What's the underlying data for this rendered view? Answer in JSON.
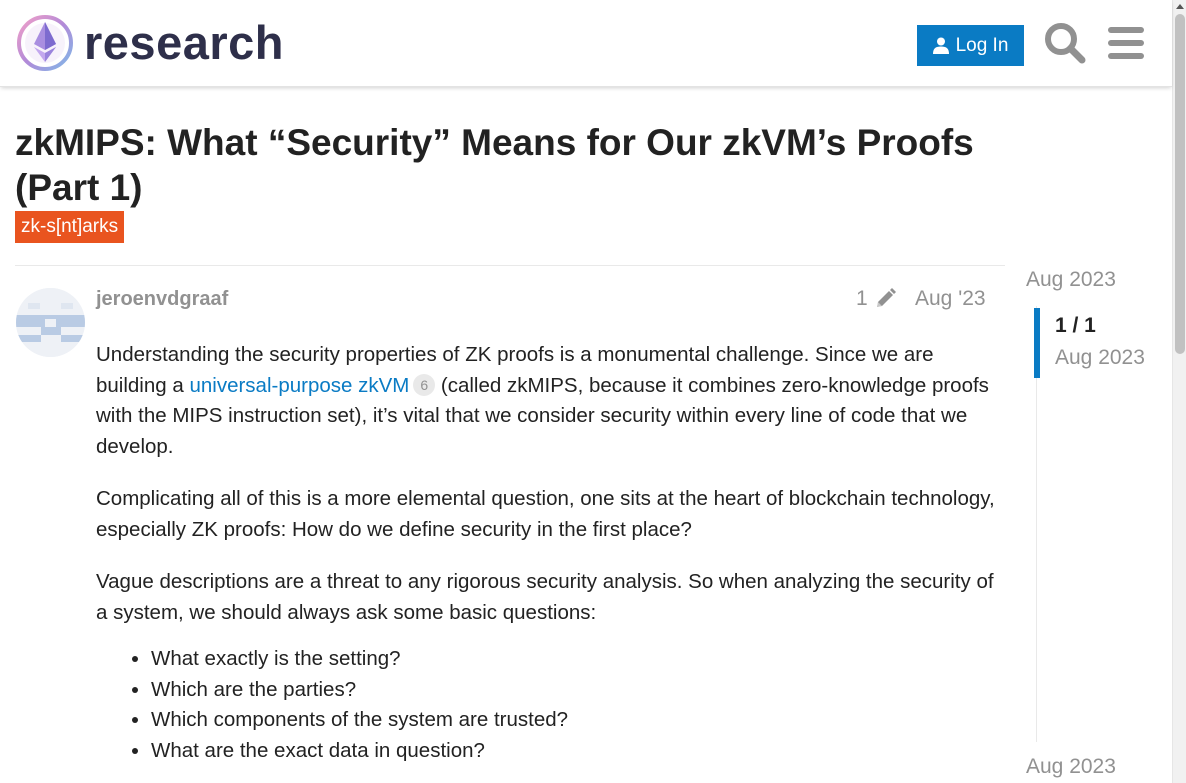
{
  "site": {
    "logo_text": "research",
    "login_label": "Log In",
    "search_icon": "search-icon",
    "menu_icon": "hamburger-menu-icon",
    "accent_color": "#0a7bc4"
  },
  "topic": {
    "title": "zkMIPS: What “Security” Means for Our zkVM’s Proofs (Part 1)",
    "tag": "zk-s[nt]arks",
    "tag_color": "#e9541f"
  },
  "post": {
    "username": "jeroenvdgraaf",
    "edit_count": "1",
    "date": "Aug '23",
    "p1_before": "Understanding the security properties of ZK proofs is a monumental challenge. Since we are building a ",
    "p1_link": "universal-purpose zkVM",
    "p1_link_clicks": "6",
    "p1_after": " (called zkMIPS, because it combines zero-knowledge proofs with the MIPS instruction set), it’s vital that we consider security within every line of code that we develop.",
    "p2": "Complicating all of this is a more elemental question, one sits at the heart of blockchain technology, especially ZK proofs: How do we define security in the first place?",
    "p3": "Vague descriptions are a threat to any rigorous security analysis. So when analyzing the security of a system, we should always ask some basic questions:",
    "questions": [
      "What exactly is the setting?",
      "Which are the parties?",
      "Which components of the system are trusted?",
      "What are the exact data in question?"
    ]
  },
  "timeline": {
    "start_date": "Aug 2023",
    "position": "1 / 1",
    "position_date": "Aug 2023",
    "end_date": "Aug 2023"
  }
}
